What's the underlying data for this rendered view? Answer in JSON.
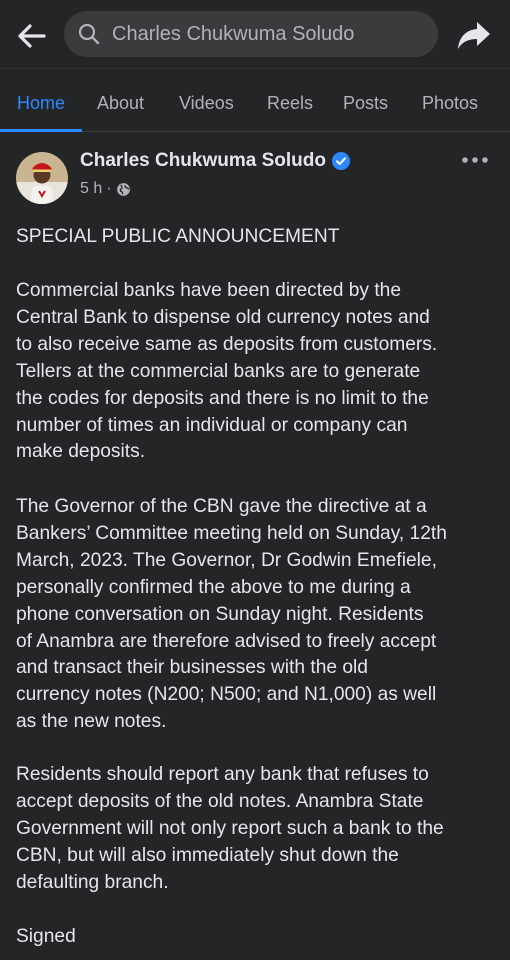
{
  "topbar": {
    "search_text": "Charles Chukwuma Soludo"
  },
  "tabs": [
    {
      "label": "Home",
      "active": true
    },
    {
      "label": "About",
      "active": false
    },
    {
      "label": "Videos",
      "active": false
    },
    {
      "label": "Reels",
      "active": false
    },
    {
      "label": "Posts",
      "active": false
    },
    {
      "label": "Photos",
      "active": false
    }
  ],
  "post": {
    "author": "Charles Chukwuma Soludo",
    "time": "5 h",
    "meta_separator": "·",
    "heading": "SPECIAL PUBLIC ANNOUNCEMENT",
    "paragraph1": [
      "Commercial banks have been directed by the",
      "Central Bank to dispense old currency notes and",
      "to also receive same as deposits from customers.",
      "Tellers at the commercial banks are to generate",
      "the codes for deposits and there is no limit to the",
      "number of times an individual or company can",
      "make deposits."
    ],
    "paragraph2": [
      "The Governor of the CBN gave the directive at a",
      "Bankers’ Committee meeting held on Sunday, 12th",
      "March, 2023. The Governor, Dr Godwin Emefiele,",
      "personally confirmed the above to me during a",
      "phone conversation on Sunday night.  Residents",
      "of Anambra are therefore advised to freely accept",
      "and transact their businesses with the old",
      "currency notes (N200; N500; and N1,000) as well",
      "as the new notes."
    ],
    "paragraph3": [
      "Residents should report any bank that refuses to",
      "accept deposits of the old notes.  Anambra State",
      "Government will not only report such a bank to the",
      "CBN, but will also immediately shut down the",
      "defaulting branch."
    ],
    "signed": "Signed"
  },
  "colors": {
    "accent": "#2d88ff",
    "background": "#18191a",
    "surface": "#242526",
    "text": "#e4e6eb",
    "secondary_text": "#b0b3b8"
  },
  "icons": {
    "back": "arrow-left-icon",
    "search": "search-icon",
    "share": "share-icon",
    "verified": "verified-badge-icon",
    "audience": "globe-icon",
    "more": "more-options-icon"
  }
}
